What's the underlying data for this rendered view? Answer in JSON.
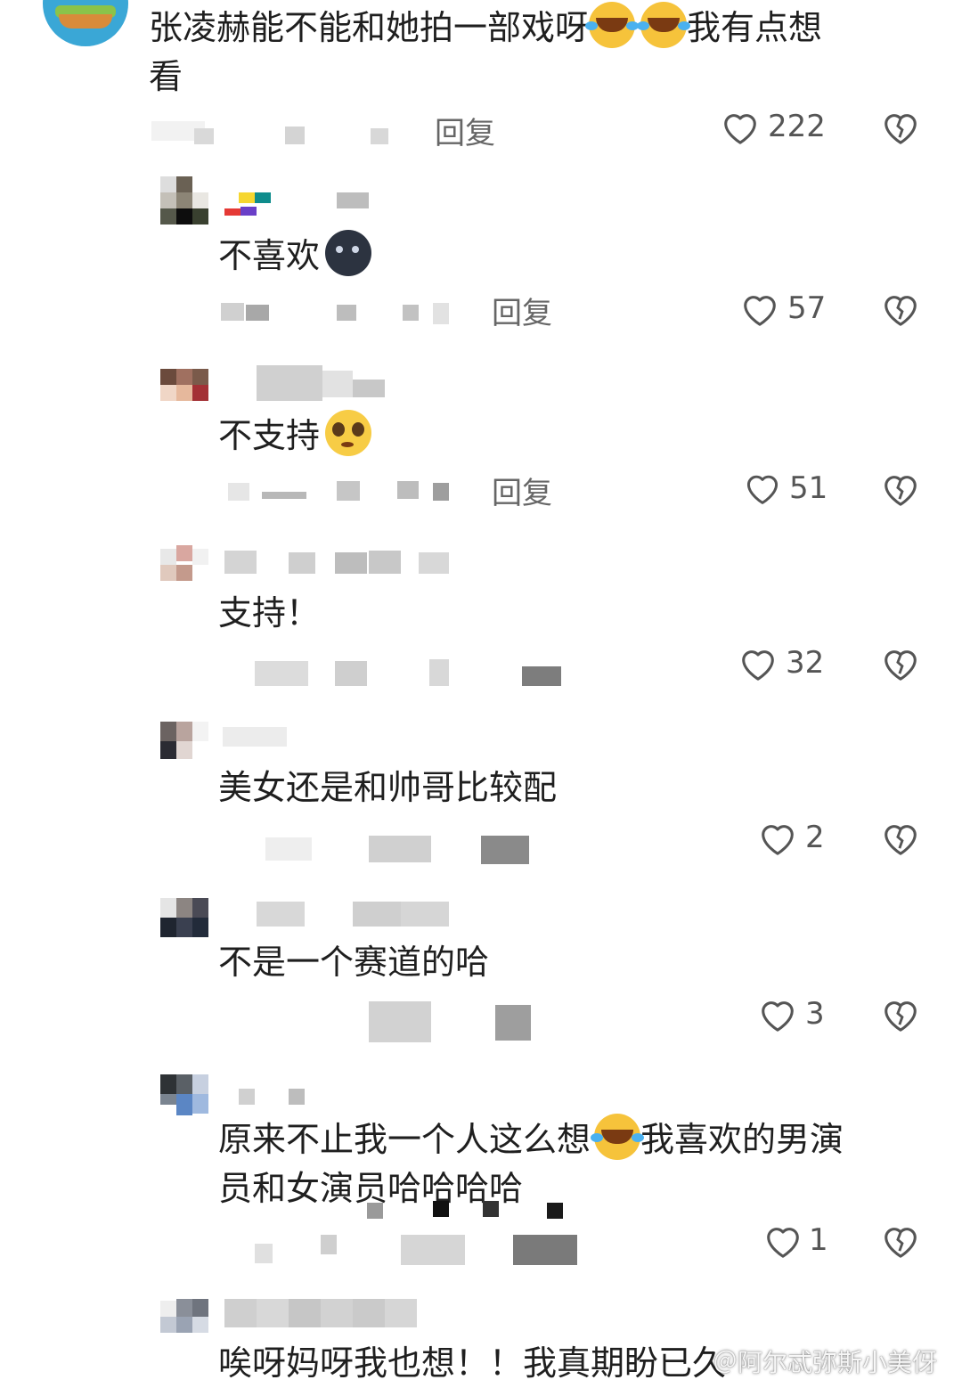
{
  "comments": [
    {
      "line1": "张凌赫能不能和她拍一部戏呀",
      "line1_tail": "我有点想",
      "line2": "看",
      "reply_label": "回复",
      "likes": "222"
    },
    {
      "text": "不喜欢",
      "reply_label": "回复",
      "likes": "57"
    },
    {
      "text": "不支持",
      "reply_label": "回复",
      "likes": "51"
    },
    {
      "text": "支持！",
      "likes": "32"
    },
    {
      "text": "美女还是和帅哥比较配",
      "likes": "2"
    },
    {
      "text": "不是一个赛道的哈",
      "likes": "3"
    },
    {
      "line1": "原来不止我一个人这么想",
      "line1_tail": "我喜欢的男演",
      "line2": "员和女演员哈哈哈哈",
      "likes": "1"
    },
    {
      "text": "唉呀妈呀我也想！！我真期盼已久"
    }
  ],
  "watermark": "＠阿尔忒弥斯小美伢",
  "colors": {
    "text": "#1f1f1f",
    "meta": "#666666",
    "icon": "#555555"
  },
  "icons": [
    "heart-outline-icon",
    "broken-heart-icon",
    "laughing-tears-emoji",
    "new-moon-face-emoji",
    "pleading-face-emoji"
  ]
}
